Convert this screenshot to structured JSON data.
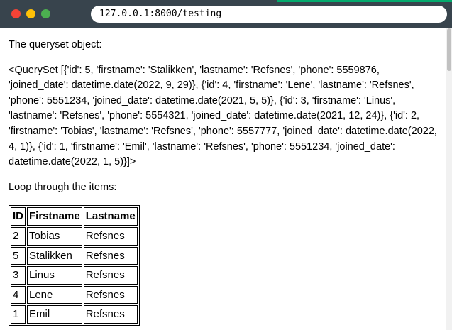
{
  "browser": {
    "url": "127.0.0.1:8000/testing"
  },
  "page": {
    "heading_text": "The queryset object:",
    "queryset_text": "<QuerySet [{'id': 5, 'firstname': 'Stalikken', 'lastname': 'Refsnes', 'phone': 5559876, 'joined_date': datetime.date(2022, 9, 29)}, {'id': 4, 'firstname': 'Lene', 'lastname': 'Refsnes', 'phone': 5551234, 'joined_date': datetime.date(2021, 5, 5)}, {'id': 3, 'firstname': 'Linus', 'lastname': 'Refsnes', 'phone': 5554321, 'joined_date': datetime.date(2021, 12, 24)}, {'id': 2, 'firstname': 'Tobias', 'lastname': 'Refsnes', 'phone': 5557777, 'joined_date': datetime.date(2022, 4, 1)}, {'id': 1, 'firstname': 'Emil', 'lastname': 'Refsnes', 'phone': 5551234, 'joined_date': datetime.date(2022, 1, 5)}]>",
    "loop_text": "Loop through the items:"
  },
  "table": {
    "headers": [
      "ID",
      "Firstname",
      "Lastname"
    ],
    "rows": [
      [
        "2",
        "Tobias",
        "Refsnes"
      ],
      [
        "5",
        "Stalikken",
        "Refsnes"
      ],
      [
        "3",
        "Linus",
        "Refsnes"
      ],
      [
        "4",
        "Lene",
        "Refsnes"
      ],
      [
        "1",
        "Emil",
        "Refsnes"
      ]
    ]
  },
  "colors": {
    "chrome": "#38444d",
    "accent": "#04aa6d",
    "close": "#f44336",
    "minimize": "#ffc107",
    "maximize": "#4caf50"
  }
}
